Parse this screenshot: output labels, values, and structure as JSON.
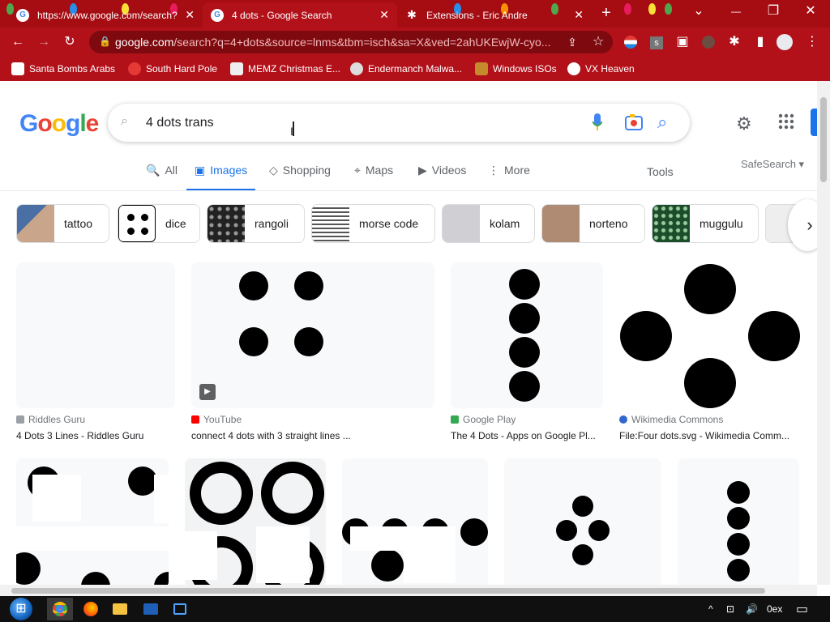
{
  "browser": {
    "tabs": [
      {
        "title": "https://www.google.com/search?",
        "close": "✕"
      },
      {
        "title": "4 dots - Google Search",
        "close": "✕"
      },
      {
        "title": "Extensions - Eric Andre",
        "close": "✕"
      }
    ],
    "new_tab": "+",
    "window_controls": {
      "tabsearch": "⌄",
      "minimize": "—",
      "restore": "❐",
      "close": "✕"
    },
    "nav": {
      "back": "←",
      "forward": "→",
      "reload": "↻"
    },
    "address": {
      "host": "google.com",
      "path": "/search?q=4+dots&source=lnms&tbm=isch&sa=X&ved=2ahUKEwjW-cyo..."
    },
    "bookmarks": [
      {
        "label": "Santa Bombs Arabs",
        "color": "#ffffff"
      },
      {
        "label": "South Hard Pole",
        "color": "#e53935"
      },
      {
        "label": "MEMZ Christmas E...",
        "color": "#eeeeee"
      },
      {
        "label": "Endermanch Malwa...",
        "color": "#dddddd"
      },
      {
        "label": "Windows ISOs",
        "color": "#c58a2c"
      },
      {
        "label": "VX Heaven",
        "color": "#ffffff"
      }
    ]
  },
  "google": {
    "logo_letters": [
      "G",
      "o",
      "o",
      "g",
      "l",
      "e"
    ],
    "logo_colors": [
      "#4285f4",
      "#ea4335",
      "#fbbc05",
      "#4285f4",
      "#34a853",
      "#ea4335"
    ],
    "search_value": "4 dots trans",
    "nav_tabs": [
      {
        "label": "All",
        "icon": "🔍"
      },
      {
        "label": "Images",
        "icon": "▣"
      },
      {
        "label": "Shopping",
        "icon": "◇"
      },
      {
        "label": "Maps",
        "icon": "⌖"
      },
      {
        "label": "Videos",
        "icon": "▶"
      },
      {
        "label": "More",
        "icon": "⋮"
      }
    ],
    "tools": "Tools",
    "safesearch": "SafeSearch ▾",
    "chips": [
      "tattoo",
      "dice",
      "rangoli",
      "morse code",
      "kolam",
      "norteno",
      "muggulu"
    ],
    "results_row1": [
      {
        "source": "Riddles Guru",
        "title": "4 Dots 3 Lines - Riddles Guru",
        "source_color": "#9aa0a6"
      },
      {
        "source": "YouTube",
        "title": "connect 4 dots with 3 straight lines ...",
        "source_color": "#ff0000"
      },
      {
        "source": "Google Play",
        "title": "The 4 Dots - Apps on Google Pl...",
        "source_color": "#34a853"
      },
      {
        "source": "Wikimedia Commons",
        "title": "File:Four dots.svg - Wikimedia Comm...",
        "source_color": "#3366cc"
      }
    ]
  },
  "taskbar": {
    "start": "⊞",
    "tray_text": "0ex",
    "tray_icons": [
      "^",
      "⊡",
      "🔊"
    ]
  }
}
